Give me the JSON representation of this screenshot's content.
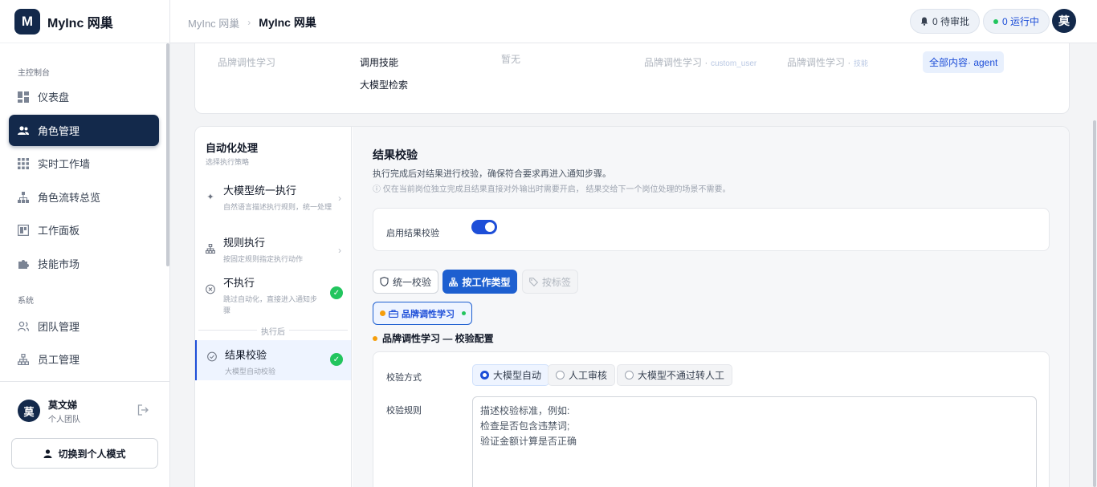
{
  "brand": {
    "logo_letter": "M",
    "name": "MyInc 网巢"
  },
  "sidebar": {
    "group_main": "主控制台",
    "group_system": "系统",
    "items": [
      {
        "label": "仪表盘",
        "icon": "dashboard-icon"
      },
      {
        "label": "角色管理",
        "icon": "users-icon",
        "active": true
      },
      {
        "label": "实时工作墙",
        "icon": "grid-icon"
      },
      {
        "label": "角色流转总览",
        "icon": "flow-icon"
      },
      {
        "label": "工作面板",
        "icon": "panel-icon"
      },
      {
        "label": "技能市场",
        "icon": "puzzle-icon"
      }
    ],
    "system_items": [
      {
        "label": "团队管理",
        "icon": "team-icon"
      },
      {
        "label": "员工管理",
        "icon": "org-icon"
      }
    ],
    "user": {
      "avatar": "莫",
      "name": "莫文娣",
      "team": "个人团队"
    },
    "switch_button": "切换到个人模式"
  },
  "header": {
    "breadcrumb": [
      "MyInc 网巢",
      "MyInc 网巢"
    ],
    "pending": "0 待审批",
    "running": "0 运行中",
    "avatar": "莫"
  },
  "top_table": {
    "col1": "品牌调性学习",
    "col2": [
      "调用技能",
      "大模型检索"
    ],
    "col3": "暂无",
    "col4": {
      "main": "品牌调性学习 ·",
      "sub": "custom_user"
    },
    "col5": {
      "main": "品牌调性学习 ·",
      "sub": "技能"
    },
    "tag": "全部内容· agent"
  },
  "steps": {
    "header_title": "自动化处理",
    "header_sub": "选择执行策略",
    "items": [
      {
        "title": "大模型统一执行",
        "desc": "自然语言描述执行规则，统一处理"
      },
      {
        "title": "规则执行",
        "desc": "按固定规则指定执行动作"
      },
      {
        "title": "不执行",
        "desc": "跳过自动化，直接进入通知步骤"
      }
    ],
    "divider": "执行后",
    "after": {
      "title": "结果校验",
      "desc": "大模型自动校验"
    }
  },
  "verify": {
    "title": "结果校验",
    "desc": "执行完成后对结果进行校验，确保符合要求再进入通知步骤。",
    "note": "ⓘ 仅在当前岗位独立完成且结果直接对外输出时需要开启， 结果交给下一个岗位处理的场景不需要。",
    "enable_label": "启用结果校验",
    "enabled": true,
    "tabs": [
      "统一校验",
      "按工作类型",
      "按标签"
    ],
    "active_tab": 1,
    "worktype_chip": "品牌调性学习",
    "config_title": "品牌调性学习 — 校验配置",
    "method_label": "校验方式",
    "methods": [
      "大模型自动",
      "人工审核",
      "大模型不通过转人工"
    ],
    "selected_method": 0,
    "rules_label": "校验规则",
    "rules_text": "描述校验标准，例如:\n检查是否包含违禁词;\n验证金额计算是否正确"
  },
  "colors": {
    "primary": "#13294b",
    "accent": "#1d4ed8",
    "success": "#22c55e",
    "warning": "#f59e0b"
  }
}
